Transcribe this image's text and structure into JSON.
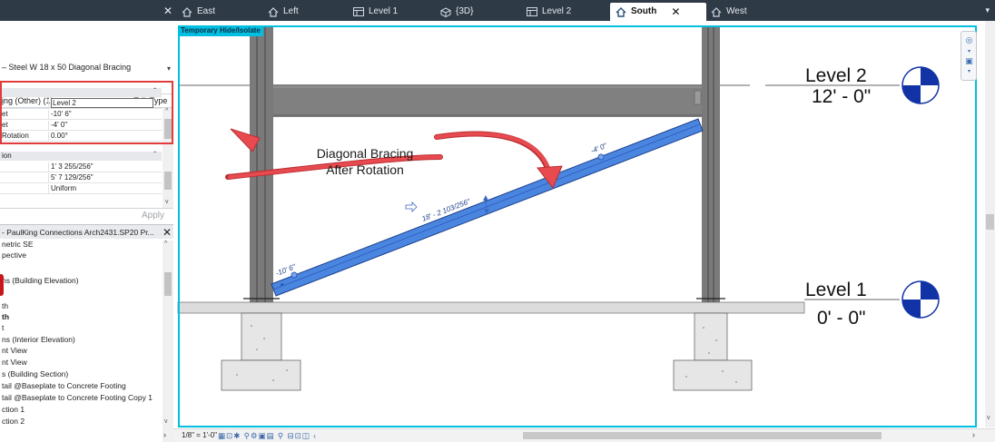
{
  "tabs": [
    {
      "label": "East",
      "icon": "elevation-icon",
      "active": false
    },
    {
      "label": "Left",
      "icon": "elevation-icon",
      "active": false
    },
    {
      "label": "Level 1",
      "icon": "floor-plan-icon",
      "active": false
    },
    {
      "label": "{3D}",
      "icon": "3d-view-icon",
      "active": false
    },
    {
      "label": "Level 2",
      "icon": "floor-plan-icon",
      "active": false
    },
    {
      "label": "South",
      "icon": "elevation-icon",
      "active": true
    },
    {
      "label": "West",
      "icon": "elevation-icon",
      "active": false
    }
  ],
  "properties": {
    "type_name": "– Steel W 18 x 50 Diagonal Bracing",
    "selector": "ing (Other) (1)",
    "edit_type": "Edit Type",
    "rows_a": [
      {
        "key": "l",
        "value": "Level 2"
      },
      {
        "key": "et",
        "value": "-10'  6\""
      },
      {
        "key": "et",
        "value": "-4'  0\""
      },
      {
        "key": "Rotation",
        "value": "0.00°"
      }
    ],
    "group_b": "ion",
    "rows_b": [
      {
        "key": "",
        "value": "1'  3 255/256\""
      },
      {
        "key": "",
        "value": "5'  7 129/256\""
      },
      {
        "key": "",
        "value": "Uniform"
      }
    ],
    "apply": "Apply"
  },
  "project_browser": {
    "title": "- PaulKing Connections Arch2431.SP20 Pr...",
    "items": [
      {
        "label": "netric SE",
        "bold": false
      },
      {
        "label": "pective",
        "bold": false
      },
      {
        "label": "",
        "bold": false
      },
      {
        "label": "ns (Building Elevation)",
        "bold": false
      },
      {
        "label": "",
        "bold": false
      },
      {
        "label": "th",
        "bold": false
      },
      {
        "label": "th",
        "bold": true
      },
      {
        "label": "t",
        "bold": false
      },
      {
        "label": "ns (Interior Elevation)",
        "bold": false
      },
      {
        "label": "nt View",
        "bold": false
      },
      {
        "label": "nt View",
        "bold": false
      },
      {
        "label": "s (Building Section)",
        "bold": false
      },
      {
        "label": "tail @Baseplate to Concrete Footing",
        "bold": false
      },
      {
        "label": "tail @Baseplate to Concrete Footing Copy 1",
        "bold": false
      },
      {
        "label": "ction 1",
        "bold": false
      },
      {
        "label": "ction 2",
        "bold": false
      }
    ]
  },
  "view": {
    "temp_label": "Temporary Hide/Isolate",
    "level2_name": "Level 2",
    "level2_elev": "12' - 0\"",
    "level1_name": "Level 1",
    "level1_elev": "0' - 0\"",
    "annotation_line1": "Diagonal Bracing",
    "annotation_line2": "After Rotation",
    "brace_length": "18' - 2 103/256\"",
    "end_offset_top": "-4'  0\"",
    "end_offset_bottom": "-10'  6\"",
    "scale": "1/8\" = 1'-0\"",
    "status_icons": "▦⊡✱ ⚲⚙▣▤ ⚲ ⊟⊡◫ ‹"
  },
  "colors": {
    "accent": "#00bfe0",
    "brace": "#4a86e0",
    "annotation_arrow": "#e84b4f",
    "steel": "#7e7e7e",
    "tab_bar": "#2f3a47"
  }
}
